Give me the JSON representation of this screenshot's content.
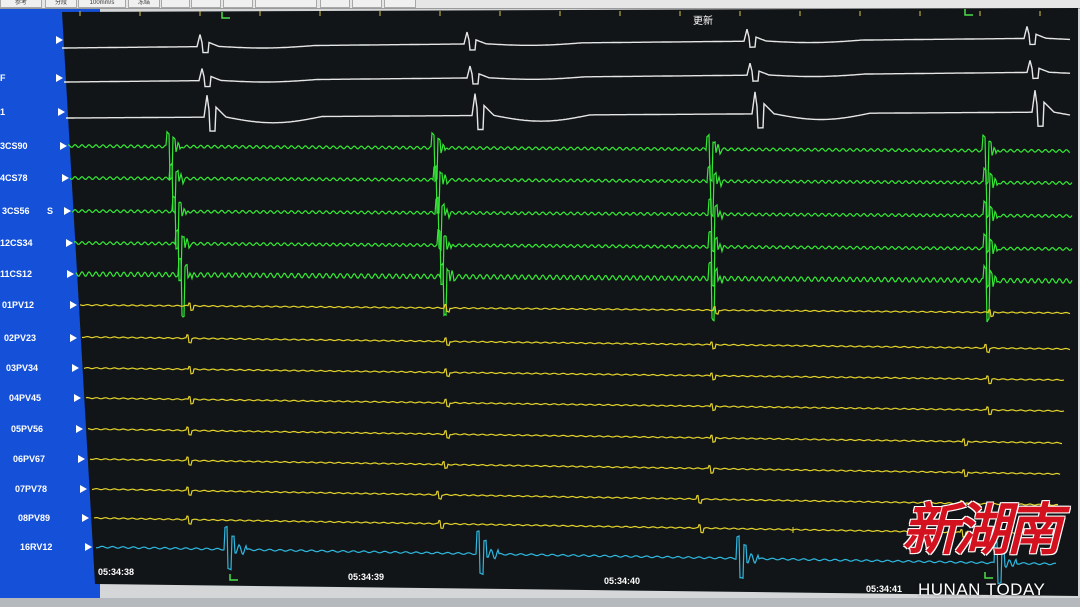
{
  "toolbar": {
    "buttons": [
      "参考",
      "分段",
      "100mm/s",
      "冻结",
      "",
      "",
      "",
      "",
      "",
      "",
      ""
    ]
  },
  "header": {
    "update_label": "更新"
  },
  "channels": [
    {
      "label": "",
      "color": "#e6e6e6",
      "group": "surface"
    },
    {
      "label": "F",
      "color": "#e6e6e6",
      "group": "surface"
    },
    {
      "label": "1",
      "color": "#e6e6e6",
      "group": "surface"
    },
    {
      "label": "3CS90",
      "color": "#35e835",
      "group": "cs"
    },
    {
      "label": "4CS78",
      "color": "#35e835",
      "group": "cs"
    },
    {
      "label": "3CS56",
      "color": "#35e835",
      "group": "cs"
    },
    {
      "label": "12CS34",
      "color": "#35e835",
      "group": "cs"
    },
    {
      "label": "11CS12",
      "color": "#35e835",
      "group": "cs"
    },
    {
      "label": "01PV12",
      "color": "#e3d22c",
      "group": "pv"
    },
    {
      "label": "02PV23",
      "color": "#e3d22c",
      "group": "pv"
    },
    {
      "label": "03PV34",
      "color": "#e3d22c",
      "group": "pv"
    },
    {
      "label": "04PV45",
      "color": "#e3d22c",
      "group": "pv"
    },
    {
      "label": "05PV56",
      "color": "#e3d22c",
      "group": "pv"
    },
    {
      "label": "06PV67",
      "color": "#e3d22c",
      "group": "pv"
    },
    {
      "label": "07PV78",
      "color": "#e3d22c",
      "group": "pv"
    },
    {
      "label": "08PV89",
      "color": "#e3d22c",
      "group": "pv"
    },
    {
      "label": "16RV12",
      "color": "#2fb8e0",
      "group": "rv"
    }
  ],
  "extra_marker": "S",
  "timestamps": [
    "05:34:38",
    "05:34:39",
    "05:34:40",
    "05:34:41"
  ],
  "watermark": {
    "logo": "新湖南",
    "subtitle": "HUNAN TODAY"
  }
}
